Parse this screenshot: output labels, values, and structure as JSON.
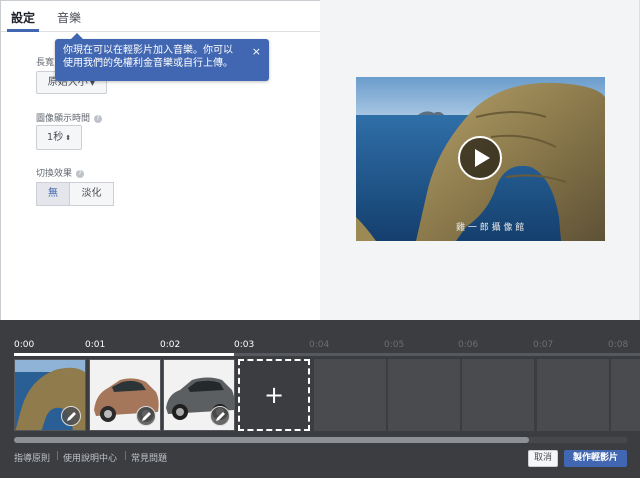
{
  "tabs": [
    {
      "label": "設定",
      "active": true
    },
    {
      "label": "音樂",
      "active": false
    }
  ],
  "tooltip": {
    "text_line1": "你現在可以在輕影片加入音樂。你可以",
    "text_line2": "使用我們的免權利金音樂或自行上傳。",
    "close_label": "×"
  },
  "settings": {
    "aspect_ratio": {
      "label": "長寬比",
      "value": "原始大小"
    },
    "image_duration": {
      "label": "圖像顯示時間",
      "value": "1秒"
    },
    "transition": {
      "label": "切換效果",
      "options": [
        "無",
        "淡化"
      ],
      "selected": "無"
    }
  },
  "preview": {
    "watermark": "雞 一 郎 攝 像 館"
  },
  "timeline": {
    "ticks": [
      {
        "label": "0:00",
        "active": true
      },
      {
        "label": "0:01",
        "active": true
      },
      {
        "label": "0:02",
        "active": true
      },
      {
        "label": "0:03",
        "active": true
      },
      {
        "label": "0:04",
        "active": false
      },
      {
        "label": "0:05",
        "active": false
      },
      {
        "label": "0:06",
        "active": false
      },
      {
        "label": "0:07",
        "active": false
      },
      {
        "label": "0:08",
        "active": false
      }
    ],
    "add_label": "+"
  },
  "footer": {
    "links": [
      "指導原則",
      "使用說明中心",
      "常見問題"
    ],
    "separator": "|",
    "cancel_label": "取消",
    "create_label": "製作輕影片"
  },
  "colors": {
    "accent": "#4267b2",
    "timeline_bg": "#3b3d40",
    "preview_bg": "#f3f4f6"
  },
  "icons": [
    "info-icon",
    "caret-down-icon",
    "close-icon",
    "play-icon",
    "pencil-icon",
    "plus-icon"
  ]
}
